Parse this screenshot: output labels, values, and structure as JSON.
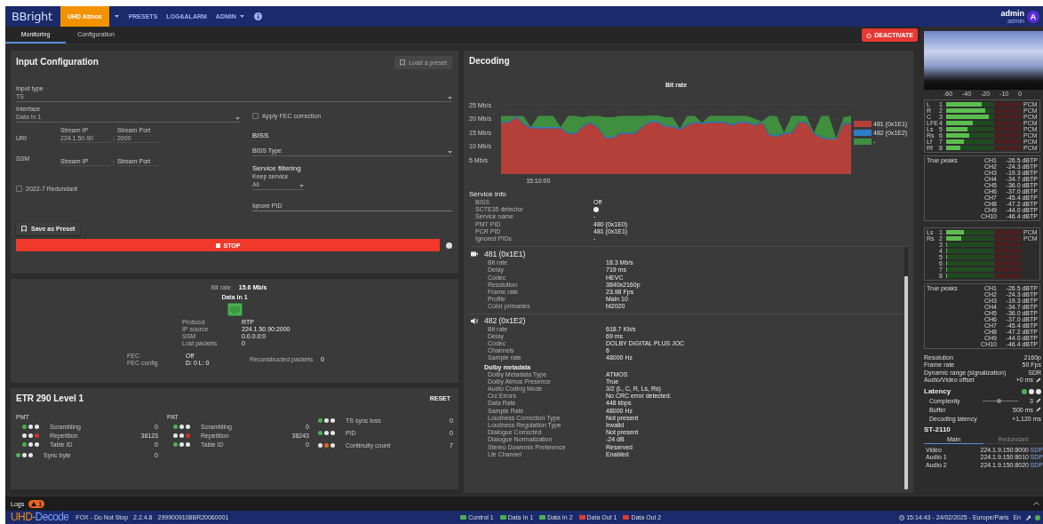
{
  "app_bar": {
    "logo": "BBright",
    "product": "UHD Atmos",
    "menu": [
      {
        "label": "PRESETS",
        "dropdown": false
      },
      {
        "label": "LOG&ALARM",
        "dropdown": false
      },
      {
        "label": "ADMIN",
        "dropdown": true
      }
    ],
    "user": {
      "name": "admin",
      "role": "admin",
      "avatar": "A"
    }
  },
  "tabs": [
    {
      "label": "Monitoring",
      "selected": true
    },
    {
      "label": "Configuration",
      "selected": false
    }
  ],
  "deactivate_button": "DEACTIVATE",
  "input_configuration": {
    "title": "Input Configuration",
    "load_preset_button": {
      "label": "Load a preset",
      "disabled": true
    },
    "input_type": {
      "label": "Input type",
      "value": "TS"
    },
    "interface": {
      "label": "Interface",
      "value": "Data In 1"
    },
    "apply_fec": {
      "label": "Apply FEC correction",
      "checked": false
    },
    "uri": {
      "label": "URI",
      "ip_label": "Stream IP",
      "ip": "224.1.50.90",
      "separator": ":",
      "port_label": "Stream Port",
      "port": "2000"
    },
    "ssm": {
      "label": "SSM",
      "ip_placeholder": "Stream IP",
      "separator": ":",
      "port_placeholder": "Stream Port"
    },
    "redundant": {
      "label": "2022-7 Redundant",
      "checked": false
    },
    "biss": {
      "title": "BISS",
      "type_placeholder": "BISS Type"
    },
    "service_filtering": {
      "title": "Service filtering",
      "keep_label": "Keep service",
      "keep_value": "All",
      "ignore_pid_placeholder": "Ignore PID"
    },
    "save_preset_button": "Save as Preset",
    "stop_button": "STOP"
  },
  "input_status": {
    "bit_rate_label": "Bit rate",
    "bit_rate": "15.6 Mb/s",
    "interface": "Data In 1",
    "details": [
      {
        "label": "Protocol",
        "value": "RTP"
      },
      {
        "label": "IP source",
        "value": "224.1.50.90:2000"
      },
      {
        "label": "SSM",
        "value": "0.0.0.0:0"
      },
      {
        "label": "Lost packets",
        "value": "0"
      }
    ],
    "fec": [
      {
        "label": "FEC",
        "value": "Off"
      },
      {
        "label": "FEC config",
        "value": "D: 0 L: 0"
      }
    ],
    "reconstructed": {
      "label": "Reconstructed packets",
      "value": "0"
    }
  },
  "etr290": {
    "title": "ETR 290 Level 1",
    "reset_button": "RESET",
    "columns": [
      {
        "title": "PMT",
        "items": [
          {
            "label": "Scrambling",
            "count": "0",
            "lights": [
              {
                "color": "#4caf50"
              },
              {
                "color": "#e6e6e6"
              },
              {
                "color": "#e6e6e6"
              }
            ]
          },
          {
            "label": "Repetition",
            "count": "38123",
            "lights": [
              {
                "color": "#e6e6e6"
              },
              {
                "color": "#e6e6e6"
              },
              {
                "color": "#d32f2f"
              }
            ]
          },
          {
            "label": "Table ID",
            "count": "0",
            "lights": [
              {
                "color": "#4caf50"
              },
              {
                "color": "#e6e6e6"
              },
              {
                "color": "#e6e6e6"
              }
            ]
          }
        ],
        "after": [
          {
            "label": "Sync byte",
            "count": "0",
            "lights": [
              {
                "color": "#4caf50"
              },
              {
                "color": "#e6e6e6"
              },
              {
                "color": "#e6e6e6"
              }
            ]
          }
        ]
      },
      {
        "title": "PAT",
        "items": [
          {
            "label": "Scrambling",
            "count": "0",
            "lights": [
              {
                "color": "#4caf50"
              },
              {
                "color": "#e6e6e6"
              },
              {
                "color": "#e6e6e6"
              }
            ]
          },
          {
            "label": "Repetition",
            "count": "38243",
            "lights": [
              {
                "color": "#e6e6e6"
              },
              {
                "color": "#e6e6e6"
              },
              {
                "color": "#d32f2f"
              }
            ]
          },
          {
            "label": "Table ID",
            "count": "0",
            "lights": [
              {
                "color": "#4caf50"
              },
              {
                "color": "#e6e6e6"
              },
              {
                "color": "#e6e6e6"
              }
            ]
          }
        ]
      },
      {
        "items": [
          {
            "label": "TS sync loss",
            "count": "0",
            "lights": [
              {
                "color": "#4caf50"
              },
              {
                "color": "#e6e6e6"
              },
              {
                "color": "#e6e6e6"
              }
            ]
          },
          {
            "label": "PID",
            "count": "0",
            "lights": [
              {
                "color": "#4caf50"
              },
              {
                "color": "#e6e6e6"
              },
              {
                "color": "#e6e6e6"
              }
            ]
          },
          {
            "label": "Continuity count",
            "count": "7",
            "lights": [
              {
                "color": "#e6e6e6"
              },
              {
                "color": "#e8641c"
              },
              {
                "color": "#e6e6e6"
              }
            ]
          }
        ]
      }
    ]
  },
  "decoding": {
    "title": "Decoding",
    "time_marker": "15:10:00",
    "chart_data": {
      "type": "area",
      "title": "Bit rate",
      "stacked": true,
      "legend": "right",
      "ylim": [
        0,
        25
      ],
      "yticks": [
        {
          "value": 5,
          "label": "5 Mb/s"
        },
        {
          "value": 10,
          "label": "10 Mb/s"
        },
        {
          "value": 15,
          "label": "15 Mb/s"
        },
        {
          "value": 20,
          "label": "20 Mb/s"
        },
        {
          "value": 25,
          "label": "25 Mb/s"
        }
      ],
      "series": [
        {
          "name": "481 (0x1E1)",
          "color": "#b5403a",
          "values": [
            18.5,
            18.5,
            20.5,
            18,
            16.5,
            16.5,
            16.5,
            16.5,
            16.5,
            14.5,
            14.5,
            17,
            18.5,
            16.5,
            13,
            13,
            14.5,
            14.5,
            14.5,
            17,
            18.7,
            18.7,
            17,
            17,
            16,
            17.5,
            18.5,
            18,
            18.5,
            18.5,
            18.5,
            17.5,
            18.5,
            18.5,
            17.5,
            18.5,
            14,
            13.5,
            14.5,
            14.5,
            18.5,
            18.5,
            14.5,
            13,
            12.5,
            12.5,
            18,
            18
          ]
        },
        {
          "name": "482 (0x1E2)",
          "color": "#2f7fc8",
          "values": [
            0.5,
            0.5,
            0.5,
            0.5,
            0.5,
            0.5,
            0.5,
            0.5,
            0.5,
            0.5,
            0.5,
            0.5,
            0.5,
            0.5,
            0.5,
            0.5,
            0.5,
            0.5,
            0.5,
            0.5,
            0.5,
            0.5,
            0.5,
            0.5,
            0.5,
            0.5,
            0.5,
            0.5,
            0.5,
            0.5,
            0.5,
            0.5,
            0.5,
            0.5,
            0.5,
            0.5,
            0.5,
            0.5,
            0.5,
            0.5,
            0.5,
            0.5,
            0.5,
            0.5,
            0.5,
            0.5,
            0.5,
            0.5
          ]
        },
        {
          "name": "-",
          "color": "#3f8f3f",
          "values": [
            2,
            2,
            0,
            2.5,
            0,
            4,
            4,
            4,
            0,
            6,
            6,
            3,
            2,
            4,
            7,
            7,
            6,
            6,
            6,
            3.5,
            2,
            2,
            3,
            3,
            0,
            3,
            2,
            0,
            2,
            2,
            2,
            3,
            2,
            2,
            2,
            0,
            6.5,
            7,
            0,
            6,
            2,
            2,
            0,
            7.5,
            8,
            0,
            2,
            2.5
          ]
        }
      ]
    },
    "service_info": {
      "title": "Service info",
      "rows": [
        {
          "kind": "text",
          "label": "BISS",
          "value": "Off"
        },
        {
          "kind": "dot",
          "label": "SCTE35 detector"
        },
        {
          "kind": "text",
          "label": "Service name",
          "value": "-"
        },
        {
          "kind": "text",
          "label": "PMT PID",
          "value": "480 (0x1E0)"
        },
        {
          "kind": "text",
          "label": "PCR PID",
          "value": "481 (0x1E1)"
        },
        {
          "kind": "text",
          "label": "Ignored PIDs",
          "value": "-"
        }
      ]
    },
    "streams": [
      {
        "kind": "video",
        "title": "481 (0x1E1)",
        "rows": [
          {
            "label": "Bit rate",
            "value": "18.3 Mb/s"
          },
          {
            "label": "Delay",
            "value": "719 ms"
          },
          {
            "label": "Codec",
            "value": "HEVC"
          },
          {
            "label": "Resolution",
            "value": "3840x2160p"
          },
          {
            "label": "Frame rate",
            "value": "23.98 Fps"
          },
          {
            "label": "Profile",
            "value": "Main 10"
          },
          {
            "label": "Color primaries",
            "value": "bt2020"
          }
        ]
      },
      {
        "kind": "audio",
        "title": "482 (0x1E2)",
        "rows": [
          {
            "label": "Bit rate",
            "value": "618.7 Kb/s"
          },
          {
            "label": "Delay",
            "value": "69 ms"
          },
          {
            "label": "Codec",
            "value": "DOLBY DIGITAL PLUS JOC"
          },
          {
            "label": "Channels",
            "value": "6"
          },
          {
            "label": "Sample rate",
            "value": "48000 Hz"
          }
        ],
        "metadata": {
          "title": "Dolby metadata",
          "rows": [
            {
              "label": "Dolby Metadata Type",
              "value": "ATMOS"
            },
            {
              "label": "Dolby Atmos Presence",
              "value": "True"
            },
            {
              "label": "Audio Coding Mode",
              "value": "3/2 (L, C, R, Ls, Rs)"
            },
            {
              "label": "Crc Errors",
              "value": "No CRC error detected."
            },
            {
              "label": "Data Rate",
              "value": "448 kbps"
            },
            {
              "label": "Sample Rate",
              "value": "48000 Hz"
            },
            {
              "label": "Loudness Correction Type",
              "value": "Not present"
            },
            {
              "label": "Loudness Regulation Type",
              "value": "Invalid"
            },
            {
              "label": "Dialogue Corrected",
              "value": "Not present"
            },
            {
              "label": "Dialogue Normalization",
              "value": "-24 dB"
            },
            {
              "label": "Stereo Downmix Preference",
              "value": "Reserved"
            },
            {
              "label": "Lfe Channel",
              "value": "Enabled"
            }
          ]
        }
      }
    ]
  },
  "side_panel": {
    "meter_scale": [
      "-60",
      "-40",
      "-20",
      "-10",
      "0"
    ],
    "audio_groups": [
      {
        "channels": [
          {
            "name": "L",
            "number": "1",
            "level": 0.48,
            "format": "PCM"
          },
          {
            "name": "R",
            "number": "2",
            "level": 0.52,
            "format": "PCM"
          },
          {
            "name": "C",
            "number": "3",
            "level": 0.57,
            "format": "PCM"
          },
          {
            "name": "LFE",
            "number": "4",
            "level": 0.36,
            "format": "PCM"
          },
          {
            "name": "Ls",
            "number": "5",
            "level": 0.29,
            "format": "PCM"
          },
          {
            "name": "Rs",
            "number": "6",
            "level": 0.31,
            "format": "PCM"
          },
          {
            "name": "Lf",
            "number": "7",
            "level": 0.24,
            "format": "PCM"
          },
          {
            "name": "Rf",
            "number": "8",
            "level": 0.19,
            "format": "PCM"
          }
        ],
        "true_peaks": {
          "title": "True peaks",
          "rows": [
            {
              "channel": "CH1",
              "value": "-26.5 dBTP"
            },
            {
              "channel": "CH2",
              "value": "-24.3 dBTP"
            },
            {
              "channel": "CH3",
              "value": "-19.3 dBTP"
            },
            {
              "channel": "CH4",
              "value": "-34.7 dBTP"
            },
            {
              "channel": "CH5",
              "value": "-36.0 dBTP"
            },
            {
              "channel": "CH6",
              "value": "-37.0 dBTP"
            },
            {
              "channel": "CH7",
              "value": "-45.4 dBTP"
            },
            {
              "channel": "CH8",
              "value": "-47.2 dBTP"
            },
            {
              "channel": "CH9",
              "value": "-44.0 dBTP"
            },
            {
              "channel": "CH10",
              "value": "-46.4 dBTP"
            }
          ]
        }
      },
      {
        "channels": [
          {
            "name": "Ls",
            "number": "1",
            "level": 0.24,
            "format": "PCM"
          },
          {
            "name": "Rs",
            "number": "2",
            "level": 0.2,
            "format": "PCM"
          },
          {
            "number": "3",
            "level": 0
          },
          {
            "number": "4",
            "level": 0
          },
          {
            "number": "5",
            "level": 0
          },
          {
            "number": "6",
            "level": 0
          },
          {
            "number": "7",
            "level": 0
          },
          {
            "number": "8",
            "level": 0
          }
        ],
        "true_peaks": {
          "title": "True peaks",
          "rows": [
            {
              "channel": "CH1",
              "value": "-26.5 dBTP"
            },
            {
              "channel": "CH2",
              "value": "-24.3 dBTP"
            },
            {
              "channel": "CH3",
              "value": "-19.3 dBTP"
            },
            {
              "channel": "CH4",
              "value": "-34.7 dBTP"
            },
            {
              "channel": "CH5",
              "value": "-36.0 dBTP"
            },
            {
              "channel": "CH6",
              "value": "-37.0 dBTP"
            },
            {
              "channel": "CH7",
              "value": "-45.4 dBTP"
            },
            {
              "channel": "CH8",
              "value": "-47.2 dBTP"
            },
            {
              "channel": "CH9",
              "value": "-44.0 dBTP"
            },
            {
              "channel": "CH10",
              "value": "-46.4 dBTP"
            }
          ]
        }
      }
    ],
    "video_info": [
      {
        "label": "Resolution",
        "value": "2160p",
        "editable": false
      },
      {
        "label": "Frame rate",
        "value": "50 Fps",
        "editable": false
      },
      {
        "label": "Dynamic range (signalization)",
        "value": "SDR",
        "editable": false
      },
      {
        "label": "Audio/Video offset",
        "value": "+0 ms",
        "editable": true
      }
    ],
    "latency": {
      "title": "Latency",
      "lights": [
        {
          "color": "#4caf50"
        },
        {
          "color": "#e6e6e6"
        },
        {
          "color": "#e6e6e6"
        }
      ],
      "rows": [
        {
          "kind": "slider",
          "label": "Complexity",
          "level": 0.45,
          "value": "3",
          "editable": true
        },
        {
          "kind": "text",
          "label": "Buffer",
          "value": "500 ms",
          "editable": true
        },
        {
          "kind": "text",
          "label": "Decoding latency",
          "value": "+1,120 ms",
          "editable": false
        }
      ]
    },
    "st2110": {
      "title": "ST-2110",
      "tabs": [
        {
          "label": "Main",
          "selected": true
        },
        {
          "label": "Redundant",
          "selected": false
        }
      ],
      "rows": [
        {
          "label": "Video",
          "address": "224.1.9.150:8000",
          "link": "SDP"
        },
        {
          "label": "Audio 1",
          "address": "224.1.9.150:8010",
          "link": "SDP"
        },
        {
          "label": "Audio 2",
          "address": "224.1.9.150:8020",
          "link": "SDP"
        }
      ]
    }
  },
  "logs": {
    "label": "Logs",
    "count": "1"
  },
  "status_bar": {
    "logo": "UHD-Decode",
    "service": "FOX - Do Not Stop",
    "version": "2.2.4.8",
    "serial": "2999009108BR20060001",
    "links": [
      {
        "label": "Control 1",
        "color": "#4caf50"
      },
      {
        "label": "Data In 1",
        "color": "#4caf50"
      },
      {
        "label": "Data In 2",
        "color": "#4caf50"
      },
      {
        "label": "Data Out 1",
        "color": "#e53935"
      },
      {
        "label": "Data Out 2",
        "color": "#e53935"
      }
    ],
    "datetime": "15:14:43 - 24/02/2025 - Europe/Paris",
    "language": "En"
  }
}
